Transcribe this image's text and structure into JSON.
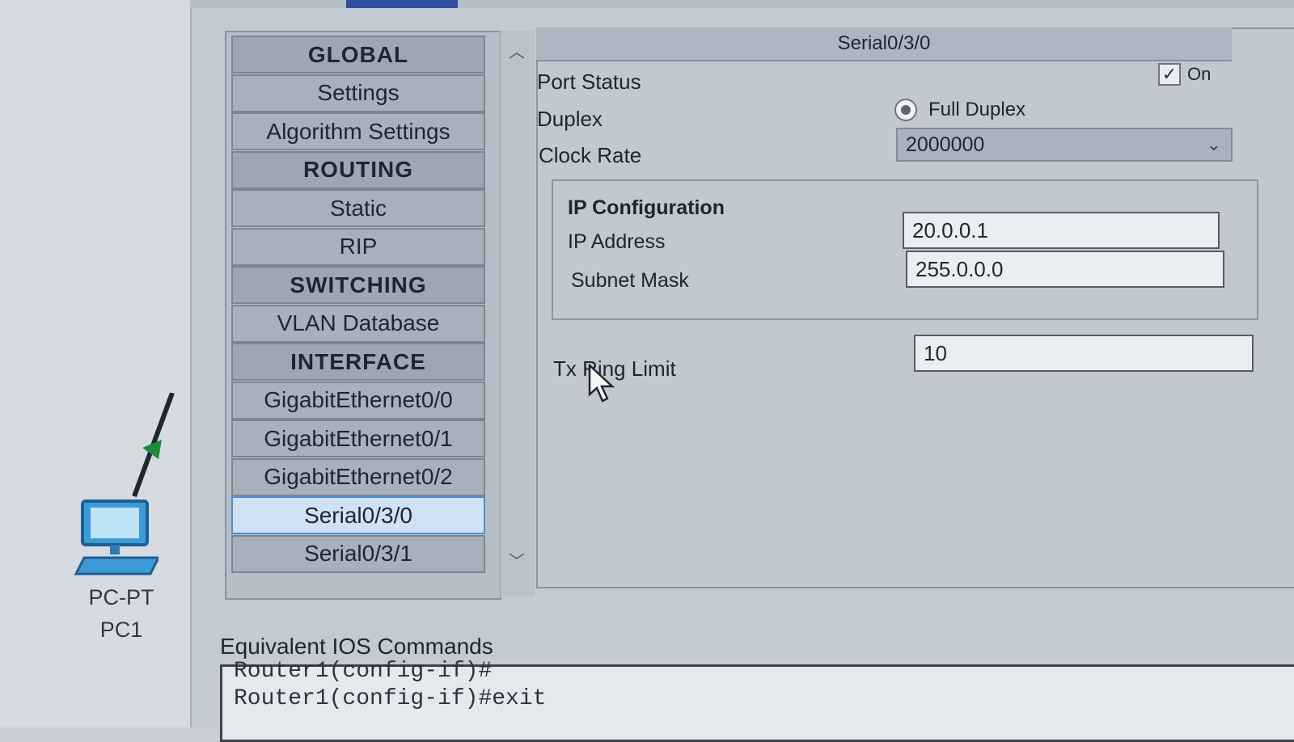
{
  "device": {
    "type_label": "PC-PT",
    "name_label": "PC1"
  },
  "nav": {
    "items": [
      {
        "label": "GLOBAL",
        "header": true
      },
      {
        "label": "Settings",
        "header": false
      },
      {
        "label": "Algorithm Settings",
        "header": false
      },
      {
        "label": "ROUTING",
        "header": true
      },
      {
        "label": "Static",
        "header": false
      },
      {
        "label": "RIP",
        "header": false
      },
      {
        "label": "SWITCHING",
        "header": true
      },
      {
        "label": "VLAN Database",
        "header": false
      },
      {
        "label": "INTERFACE",
        "header": true
      },
      {
        "label": "GigabitEthernet0/0",
        "header": false
      },
      {
        "label": "GigabitEthernet0/1",
        "header": false
      },
      {
        "label": "GigabitEthernet0/2",
        "header": false
      },
      {
        "label": "Serial0/3/0",
        "header": false,
        "selected": true
      },
      {
        "label": "Serial0/3/1",
        "header": false
      }
    ],
    "scroll_up_icon": "chevron-up-icon",
    "scroll_down_icon": "chevron-down-icon"
  },
  "panel": {
    "title": "Serial0/3/0",
    "port_status_label": "Port Status",
    "port_status_on_label": "On",
    "port_status_checked": true,
    "duplex_label": "Duplex",
    "duplex_option": "Full Duplex",
    "clock_rate_label": "Clock Rate",
    "clock_rate_value": "2000000",
    "ip_config_label": "IP Configuration",
    "ip_address_label": "IP Address",
    "ip_address_value": "20.0.0.1",
    "subnet_mask_label": "Subnet Mask",
    "subnet_mask_value": "255.0.0.0",
    "tx_ring_label": "Tx Ring Limit",
    "tx_ring_value": "10"
  },
  "ios": {
    "label": "Equivalent IOS Commands",
    "lines": [
      "Router1(config-if)#",
      "Router1(config-if)#exit"
    ]
  },
  "colors": {
    "selected_bg": "#cfe1f2",
    "selected_border": "#4f8fd0",
    "accent_strip": "#4a5aa8"
  }
}
